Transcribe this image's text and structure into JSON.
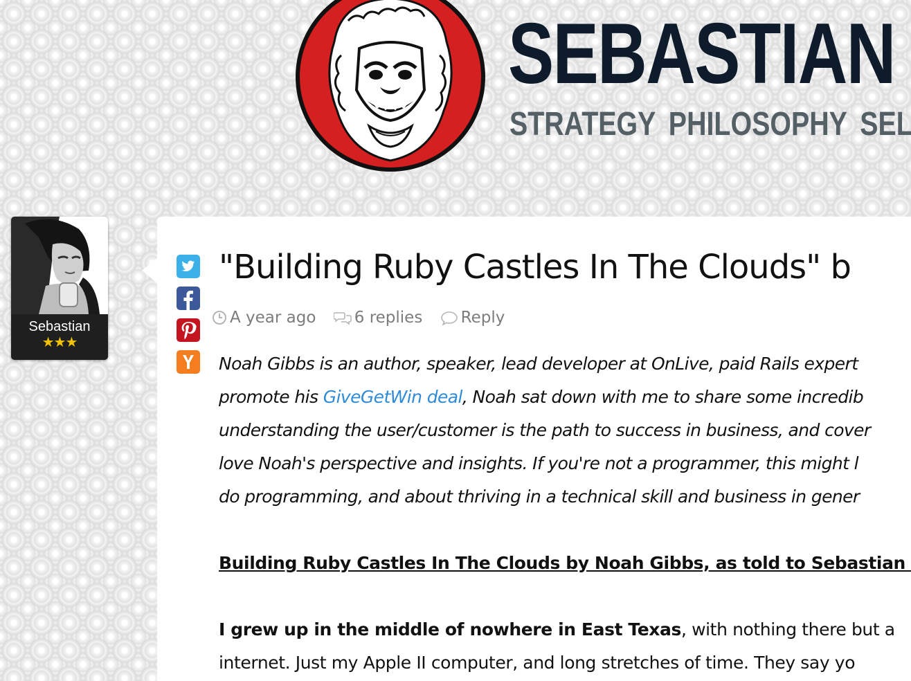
{
  "header": {
    "brand_name": "SEBASTIAN",
    "tagline": "STRATEGY PHILOSOPHY SELF-",
    "logo_icon": "guardian-lion-logo",
    "logo_color": "#d42020"
  },
  "author": {
    "name": "Sebastian",
    "stars": "★★★",
    "star_color": "#f2c200"
  },
  "share": {
    "icons": [
      "twitter-icon",
      "facebook-icon",
      "pinterest-icon",
      "hacker-news-icon"
    ],
    "colors": {
      "twitter": "#3bb0e9",
      "facebook": "#3b5998",
      "pinterest": "#c4141f",
      "hacker_news": "#f47d20"
    }
  },
  "post": {
    "title": "\"Building Ruby Castles In The Clouds\" b",
    "meta": {
      "time": "A year ago",
      "replies": "6 replies",
      "reply": "Reply"
    },
    "intro": {
      "line1": "Noah Gibbs is an author, speaker, lead developer at OnLive, paid Rails expert",
      "line2_before": "promote his ",
      "line2_link": "GiveGetWin deal",
      "line2_after": ", Noah sat down with me to share some incredib",
      "line3": "understanding the user/customer is the path to success in business, and cover",
      "line4": "love Noah's perspective and insights. If you're not a programmer, this might l",
      "line5": "do programming, and about thriving in a technical skill and business in gener"
    },
    "story_heading": "Building Ruby Castles In The Clouds by Noah Gibbs, as told to Sebastian M",
    "story": {
      "line1_bold": "I grew up in the middle of nowhere in East Texas",
      "line1_rest": ", with nothing there but a",
      "line2": "internet. Just my Apple II computer, and long stretches of time. They say yo"
    },
    "link_color": "#2f8bd7"
  }
}
